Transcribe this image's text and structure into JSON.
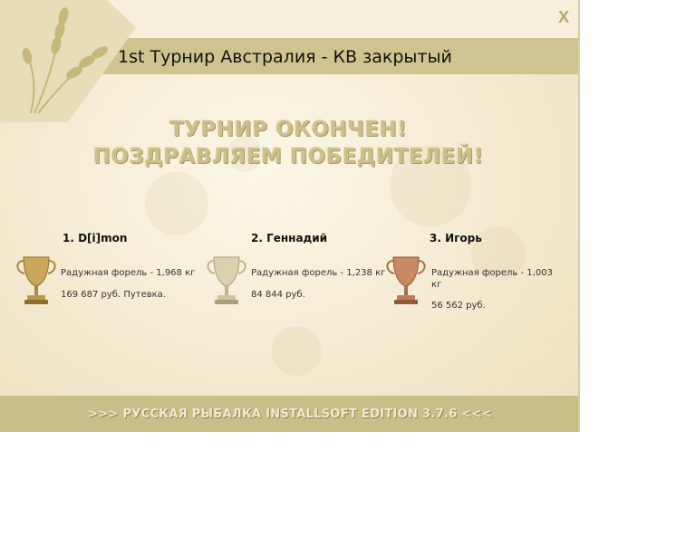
{
  "window": {
    "title": "1st Турнир Австралия - КВ закрытый",
    "close_label": "X"
  },
  "headline": {
    "line1": "ТУРНИР ОКОНЧЕН!",
    "line2": "ПОЗДРАВЛЯЕМ ПОБЕДИТЕЛЕЙ!"
  },
  "winners": [
    {
      "name": "1. D[i]mon",
      "fish": "Радужная форель - 1,968 кг",
      "prize": "169 687 руб. Путевка.",
      "cup": "gold-cup-icon"
    },
    {
      "name": "2. Геннадий",
      "fish": "Радужная форель - 1,238 кг",
      "prize": "84 844 руб.",
      "cup": "silver-cup-icon"
    },
    {
      "name": "3. Игорь",
      "fish": "Радужная форель - 1,003 кг",
      "prize": "56 562 руб.",
      "cup": "bronze-cup-icon"
    }
  ],
  "footer": {
    "text": ">>> РУССКАЯ РЫБАЛКА INSTALLSOFT EDITION 3.7.6 <<<"
  },
  "colors": {
    "title_bar": "#cfc48f",
    "footer_bar": "#c9bd88",
    "background": "#f3ead0",
    "gold": "#c9a85a",
    "silver": "#d9d2b0",
    "bronze": "#c78a62"
  }
}
